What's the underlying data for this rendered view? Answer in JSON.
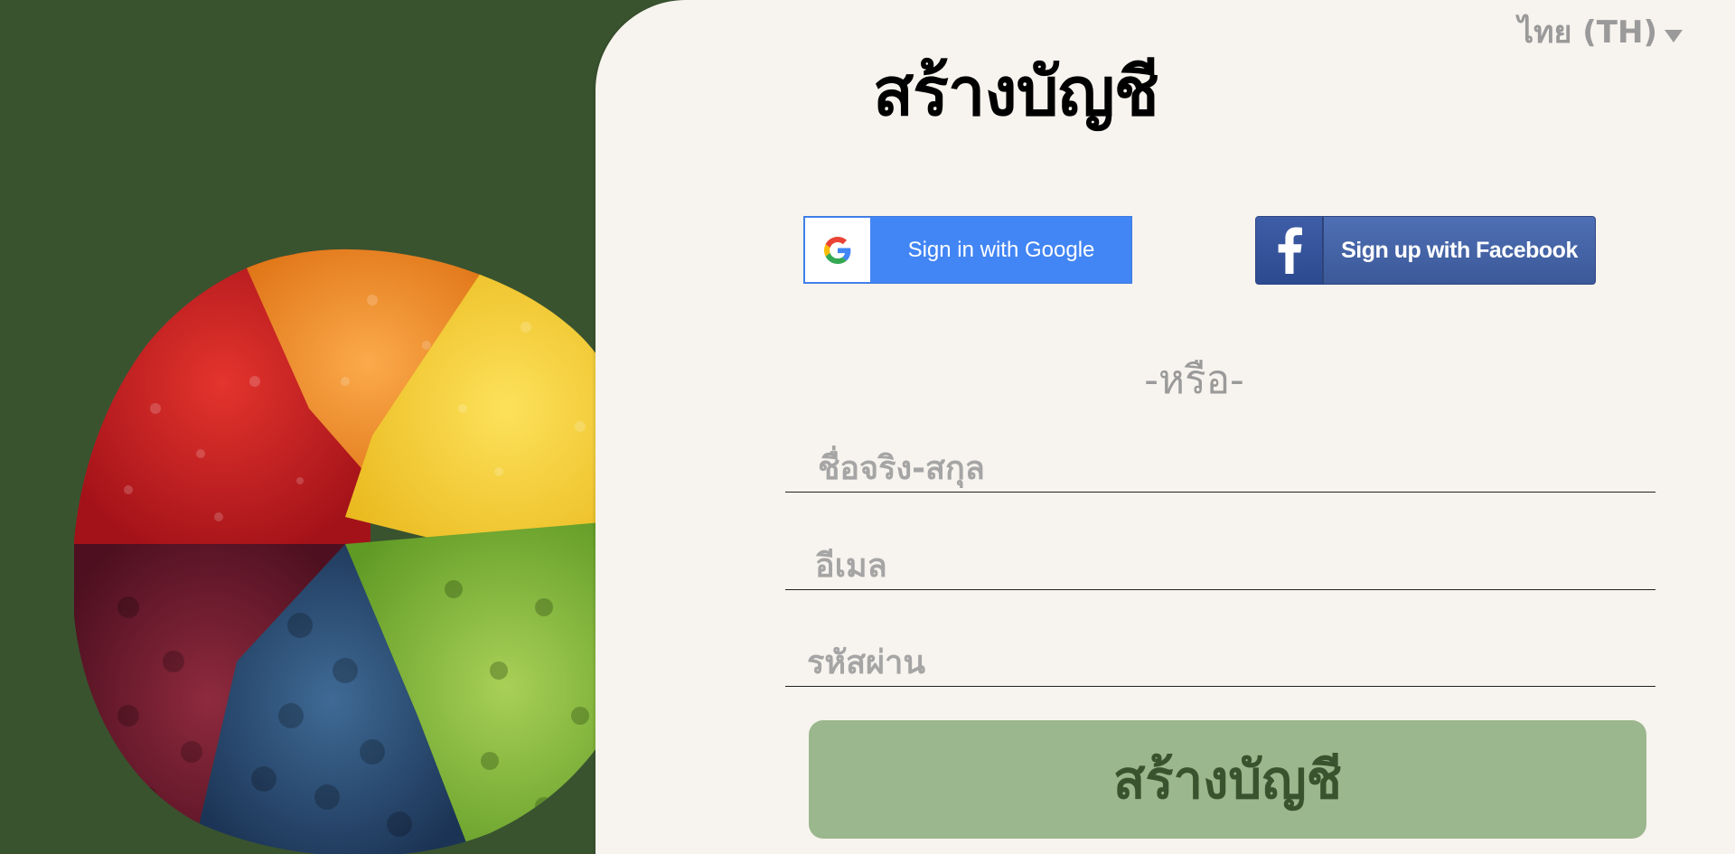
{
  "language": {
    "selected": "ไทย (TH)",
    "icon": "caret-down-icon"
  },
  "page": {
    "title": "สร้างบัญชี"
  },
  "social": {
    "google_label": "Sign in with Google",
    "google_icon": "google-g-icon",
    "facebook_label": "Sign up with Facebook",
    "facebook_icon": "facebook-f-icon"
  },
  "divider": {
    "text": "-หรือ-"
  },
  "form": {
    "name_placeholder": "ชื่อจริง-สกุล",
    "email_placeholder": "อีเมล",
    "password_placeholder": "รหัสผ่าน",
    "submit_label": "สร้างบัญชี"
  },
  "colors": {
    "brand_green": "#39532f",
    "light_green": "#9bb78d",
    "panel_bg": "#f7f3ee",
    "google_blue": "#4285f4",
    "facebook_blue": "#3b5998"
  }
}
